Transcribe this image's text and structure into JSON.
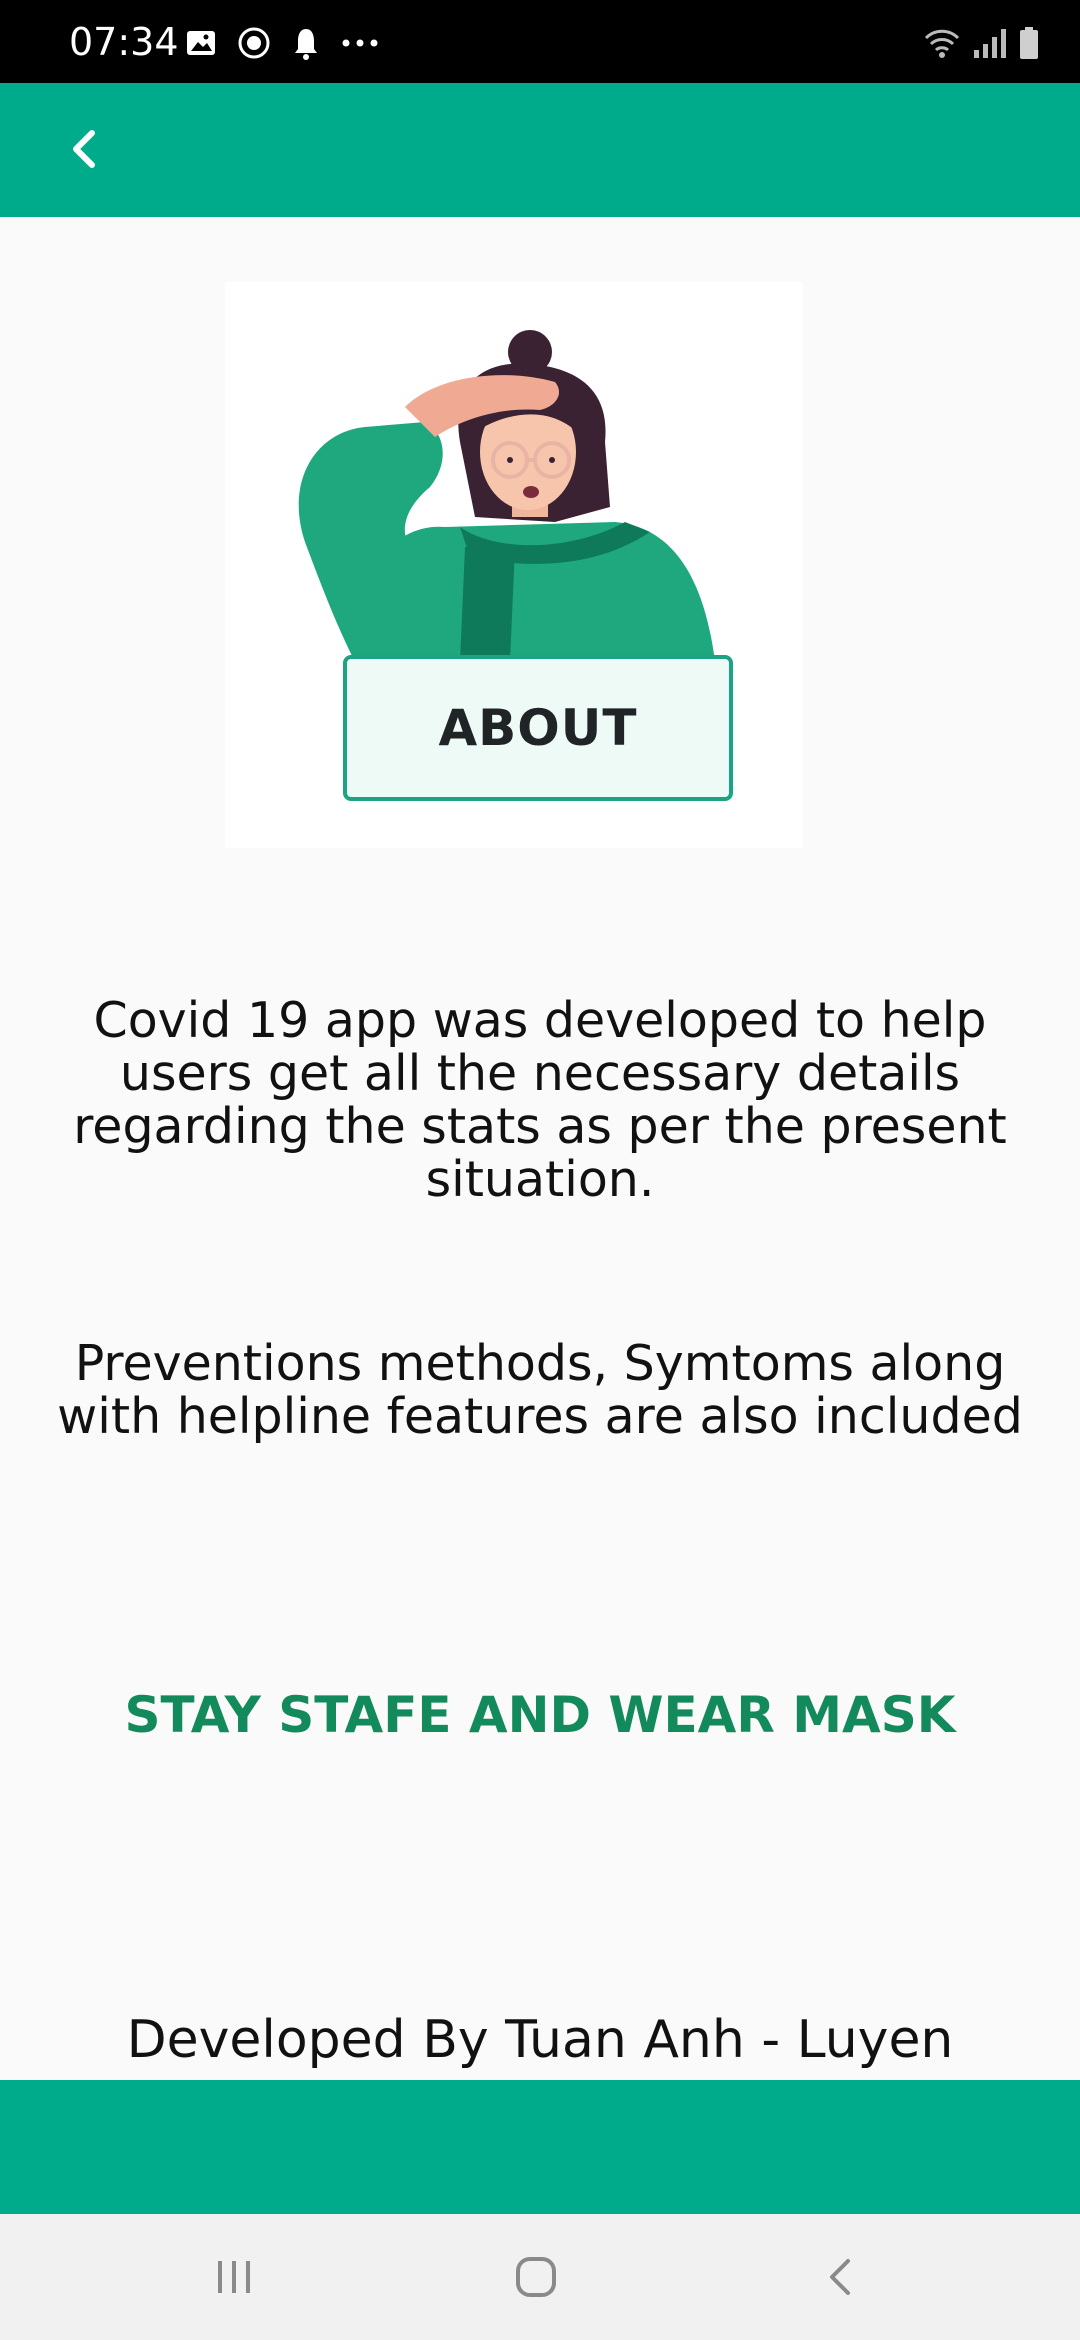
{
  "status_bar": {
    "time": "07:34",
    "left_icons": [
      "gallery-icon",
      "dnd-icon",
      "notification-icon",
      "more-dots-icon"
    ],
    "right_icons": [
      "wifi-icon",
      "signal-icon",
      "battery-icon"
    ]
  },
  "app_bar": {
    "back_icon": "chevron-left-icon",
    "color": "#00ab8b"
  },
  "hero": {
    "badge_label": "ABOUT",
    "illustration": "woman-with-mask-illustration"
  },
  "content": {
    "description_1": "Covid 19 app was developed to help users get all the necessary details regarding the stats as per the present situation.",
    "description_2": "Preventions methods, Symtoms along with helpline features are also included",
    "tagline": "STAY STAFE AND WEAR MASK",
    "tagline_color": "#138a5b",
    "credit": "Developed By Tuan Anh - Luyen"
  },
  "nav_bar": {
    "recent_icon": "recent-apps-icon",
    "home_icon": "home-icon",
    "back_icon": "back-icon"
  }
}
